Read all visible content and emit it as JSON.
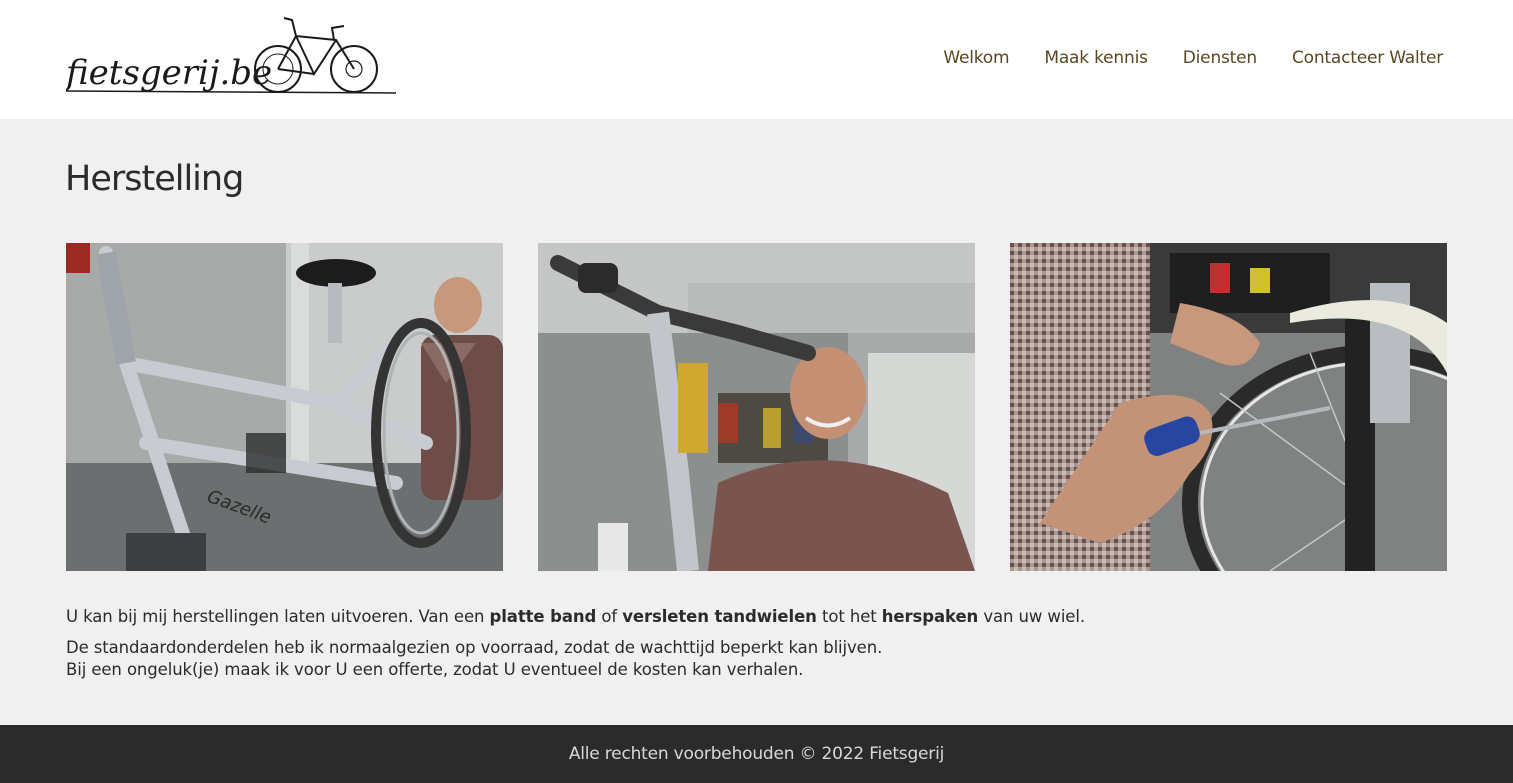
{
  "header": {
    "logo_text": "fietsgerij.be",
    "nav": [
      {
        "label": "Welkom"
      },
      {
        "label": "Maak kennis"
      },
      {
        "label": "Diensten"
      },
      {
        "label": "Contacteer Walter"
      }
    ]
  },
  "main": {
    "title": "Herstelling",
    "paragraph1": {
      "t1": "U kan bij mij herstellingen laten uitvoeren.  Van een ",
      "b1": "platte band",
      "t2": " of ",
      "b2": "versleten tandwielen",
      "t3": " tot het ",
      "b3": "herspaken",
      "t4": " van uw wiel."
    },
    "paragraph2": {
      "line1": "De standaardonderdelen heb ik normaalgezien op voorraad, zodat de wachttijd beperkt kan blijven.",
      "line2": "Bij een ongeluk(je) maak ik voor U een offerte, zodat U eventueel de kosten kan verhalen."
    },
    "photo1_frame_text": "Gazelle"
  },
  "footer": {
    "copyright": "Alle rechten voorbehouden © 2022 Fietsgerij"
  },
  "colors": {
    "nav_text": "#5a4622",
    "header_bg": "#ffffff",
    "page_bg": "#f0f0f0",
    "footer_bg": "#2b2b2b",
    "footer_text": "#d8d8d8"
  }
}
